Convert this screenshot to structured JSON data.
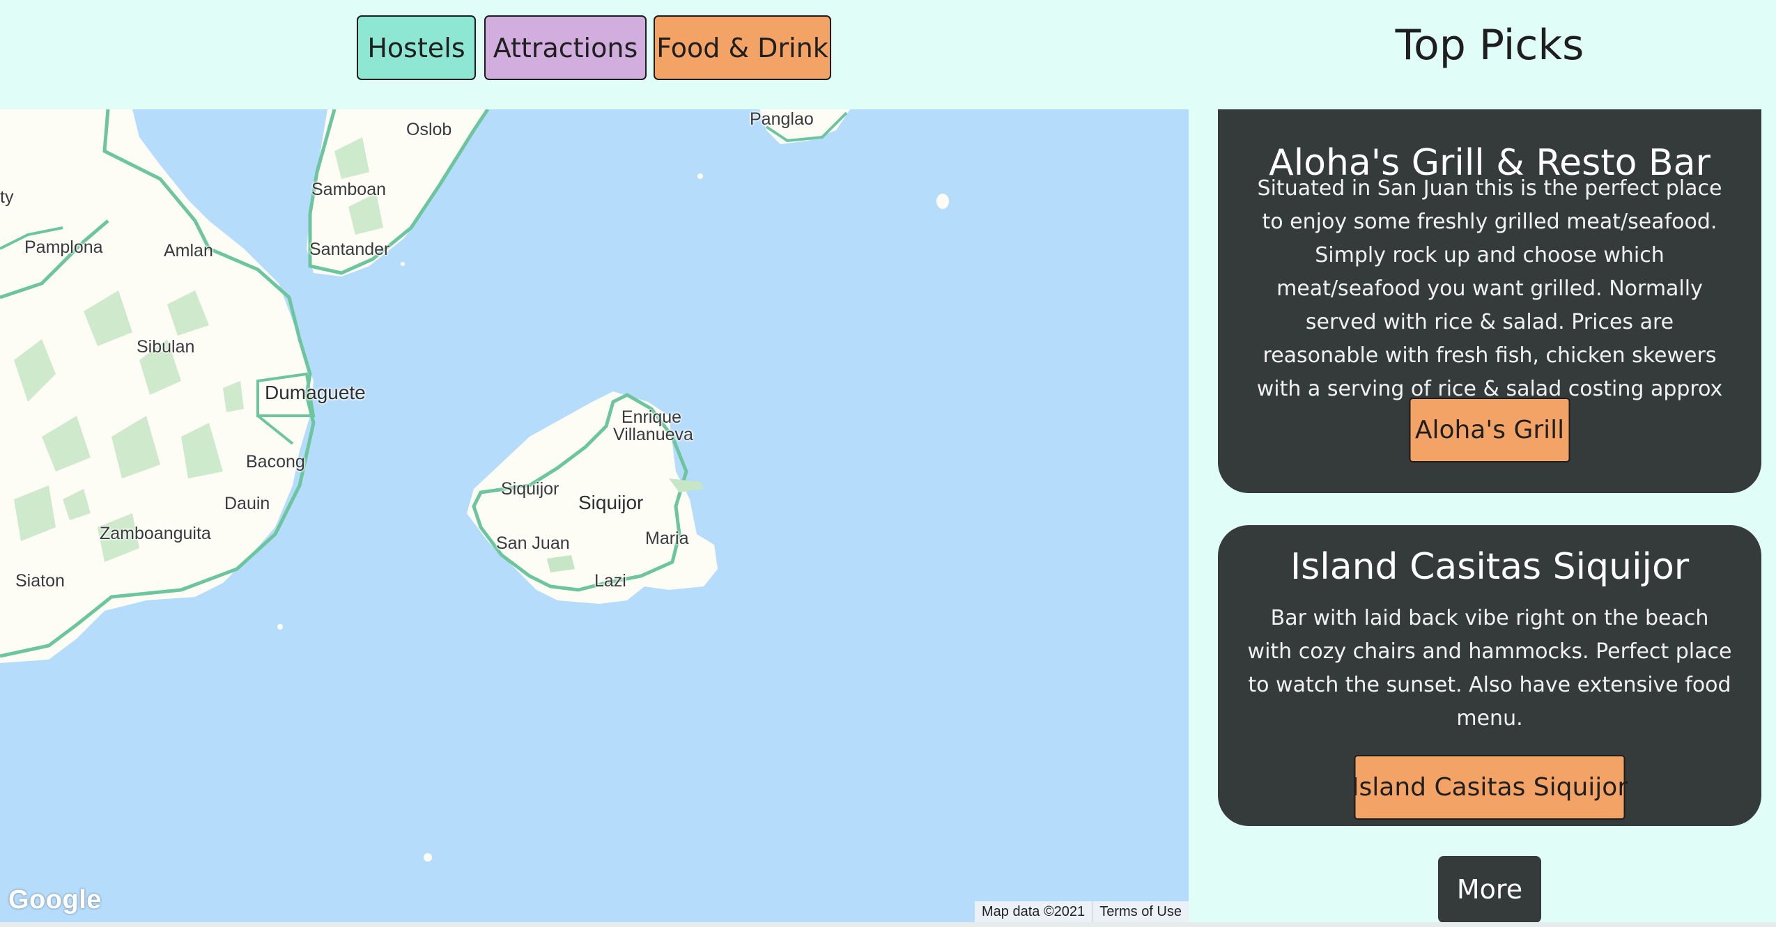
{
  "nav": {
    "hostels_label": "Hostels",
    "attractions_label": "Attractions",
    "food_label": "Food & Drink"
  },
  "panel": {
    "title": "Top Picks",
    "more_label": "More",
    "cards": [
      {
        "title": "Aloha's Grill & Resto Bar",
        "description": "Situated in San Juan this is the perfect place to enjoy some freshly grilled meat/seafood. Simply rock up and choose which meat/seafood you want grilled. Normally served with rice & salad. Prices are reasonable with fresh fish, chicken skewers with a serving of rice & salad costing approx $5.",
        "button_label": "Aloha's Grill"
      },
      {
        "title": "Island Casitas Siquijor",
        "description": "Bar with laid back vibe right on the beach with cozy chairs and hammocks. Perfect place to watch the sunset. Also have extensive food menu.",
        "button_label": "Island Casitas Siquijor"
      }
    ]
  },
  "map": {
    "places": [
      "Oslob",
      "Panglao",
      "Samboan",
      "Santander",
      "Pamplona",
      "Amlan",
      "Sibulan",
      "Dumaguete",
      "Bacong",
      "Dauin",
      "Zamboanguita",
      "Siaton",
      "Enrique Villanueva",
      "Siquijor",
      "Siquijor",
      "San Juan",
      "Maria",
      "Lazi",
      "ty"
    ],
    "logo": "Google",
    "attribution_data": "Map data ©2021",
    "attribution_terms": "Terms of Use"
  },
  "colors": {
    "page_bg": "#e0fdf8",
    "water": "#b6dcfc",
    "land": "#fdfdf6",
    "road": "#6cc59c",
    "hostels": "#8ee7d2",
    "attractions": "#d2aede",
    "food": "#f3a366",
    "card_bg": "#353b3b"
  }
}
